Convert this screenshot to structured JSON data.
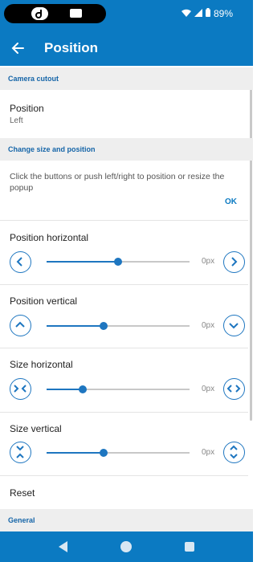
{
  "status_bar": {
    "battery": "89%"
  },
  "app_bar": {
    "title": "Position"
  },
  "sections": {
    "camera_cutout": "Camera cutout",
    "change_size": "Change size and position",
    "general": "General"
  },
  "position_pref": {
    "title": "Position",
    "value": "Left"
  },
  "description": "Click the buttons or push left/right to position or resize the popup",
  "ok_label": "OK",
  "sliders": [
    {
      "title": "Position horizontal",
      "value": "0px",
      "level": 0.5
    },
    {
      "title": "Position vertical",
      "value": "0px",
      "level": 0.4
    },
    {
      "title": "Size horizontal",
      "value": "0px",
      "level": 0.25
    },
    {
      "title": "Size vertical",
      "value": "0px",
      "level": 0.4
    }
  ],
  "reset_label": "Reset",
  "colors": {
    "accent": "#0b7ac2",
    "control": "#1e76c0",
    "header_bg": "#eeeeee"
  }
}
